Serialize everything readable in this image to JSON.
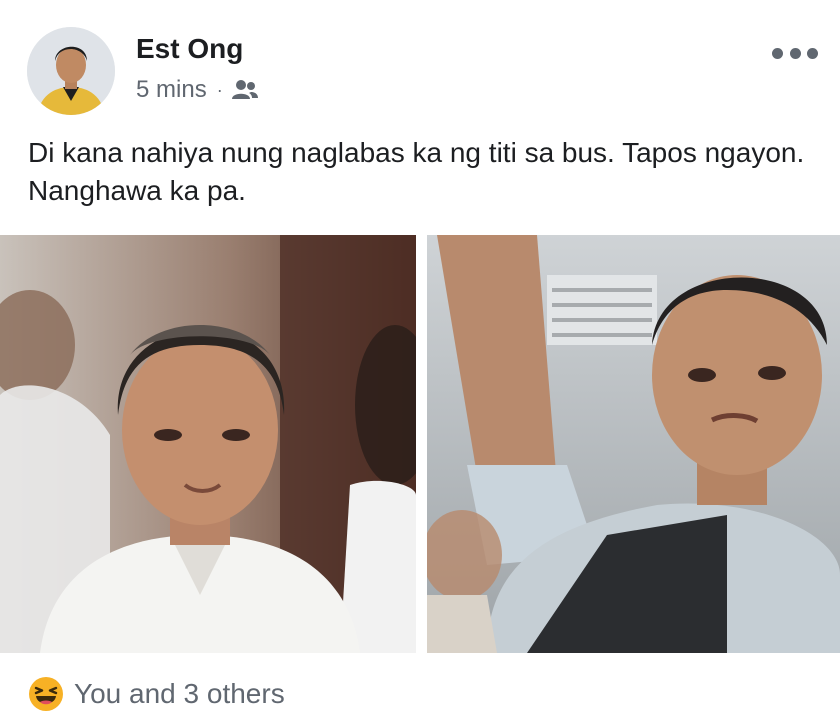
{
  "post": {
    "author": "Est Ong",
    "time": "5 mins",
    "separator": "·",
    "audience_icon": "friends-icon",
    "more_icon": "more-horizontal-icon",
    "text": "Di kana nahiya nung naglabas ka ng titi sa bus. Tapos ngayon. Nanghawa ka pa."
  },
  "photos": [
    {
      "description_icon": "photo-man-white-shirt"
    },
    {
      "description_icon": "photo-man-on-bus"
    }
  ],
  "reactions": {
    "icon": "haha-reaction-icon",
    "summary": "You and 3 others"
  },
  "colors": {
    "text": "#1c1e21",
    "secondary": "#606770",
    "reaction_yellow": "#f7b125"
  }
}
